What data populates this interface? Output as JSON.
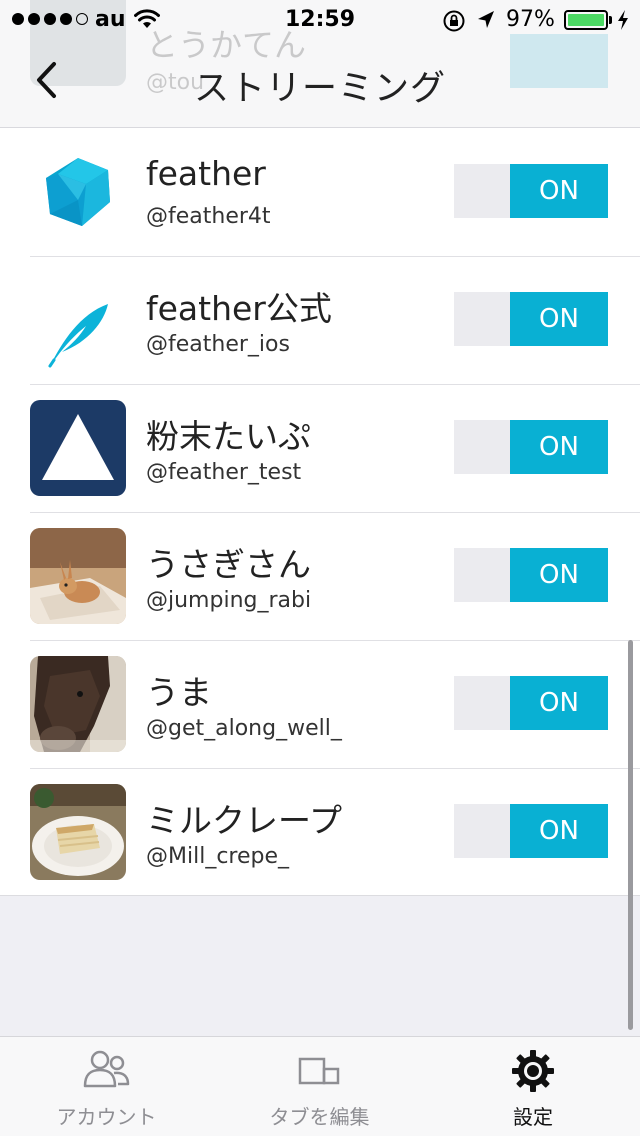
{
  "status_bar": {
    "carrier": "au",
    "time": "12:59",
    "battery_percent": "97%"
  },
  "nav": {
    "title": "ストリーミング"
  },
  "ghost_row": {
    "name": "とうかてん",
    "handle": "@tou",
    "toggle_label": "ON"
  },
  "accounts": [
    {
      "name": "feather",
      "handle": "@feather4t",
      "toggle_label": "ON",
      "avatar": "feather-cube-logo"
    },
    {
      "name": "feather公式",
      "handle": "@feather_ios",
      "toggle_label": "ON",
      "avatar": "feather-quill-logo"
    },
    {
      "name": "粉末たいぷ",
      "handle": "@feather_test",
      "toggle_label": "ON",
      "avatar": "triangle-logo"
    },
    {
      "name": "うさぎさん",
      "handle": "@jumping_rabi",
      "toggle_label": "ON",
      "avatar": "rabbit-photo"
    },
    {
      "name": "うま",
      "handle": "@get_along_well_",
      "toggle_label": "ON",
      "avatar": "alpaca-photo"
    },
    {
      "name": "ミルクレープ",
      "handle": "@Mill_crepe_",
      "toggle_label": "ON",
      "avatar": "crepe-cake-photo"
    }
  ],
  "tabs": [
    {
      "label": "アカウント",
      "icon": "people-icon",
      "active": false
    },
    {
      "label": "タブを編集",
      "icon": "tabs-icon",
      "active": false
    },
    {
      "label": "設定",
      "icon": "gear-icon",
      "active": true
    }
  ],
  "colors": {
    "accent": "#09b0d3",
    "toggle_off_track": "#ebebef",
    "background": "#efeff4",
    "battery": "#4cd964"
  }
}
